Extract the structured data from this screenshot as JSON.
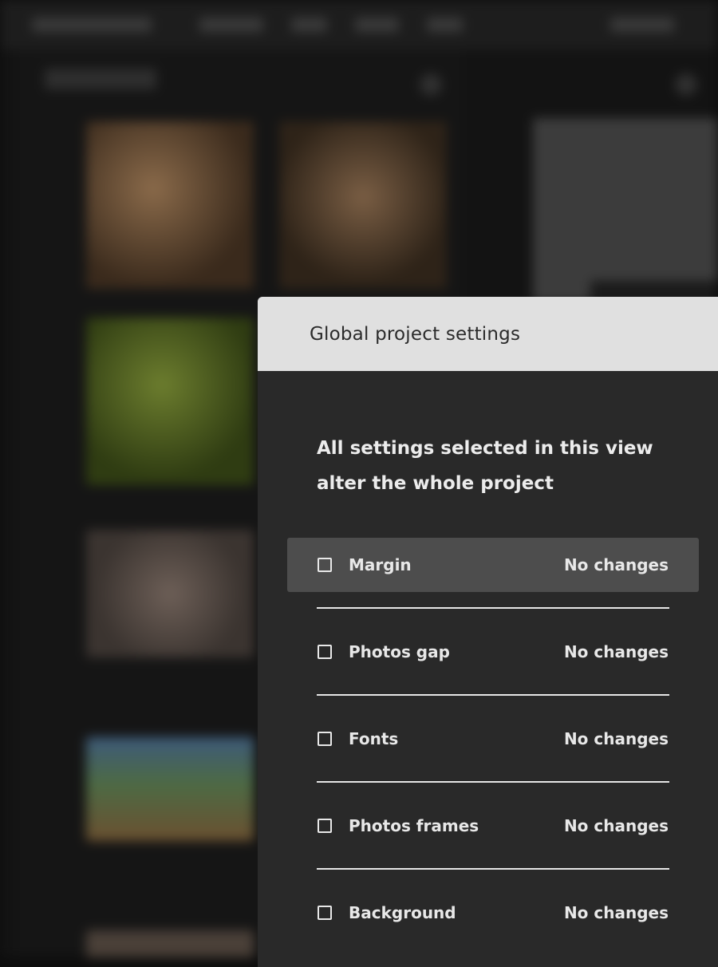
{
  "modal": {
    "title": "Global project settings",
    "description": "All settings selected in this view alter the whole project",
    "settings": [
      {
        "label": "Margin",
        "status": "No changes",
        "checked": false,
        "highlighted": true
      },
      {
        "label": "Photos gap",
        "status": "No changes",
        "checked": false,
        "highlighted": false
      },
      {
        "label": "Fonts",
        "status": "No changes",
        "checked": false,
        "highlighted": false
      },
      {
        "label": "Photos frames",
        "status": "No changes",
        "checked": false,
        "highlighted": false
      },
      {
        "label": "Background",
        "status": "No changes",
        "checked": false,
        "highlighted": false
      }
    ]
  },
  "colors": {
    "header_bg": "#e0e0e0",
    "panel_bg": "#292929",
    "highlight_row": "#4d4d4d",
    "text": "#e8e8e8"
  }
}
